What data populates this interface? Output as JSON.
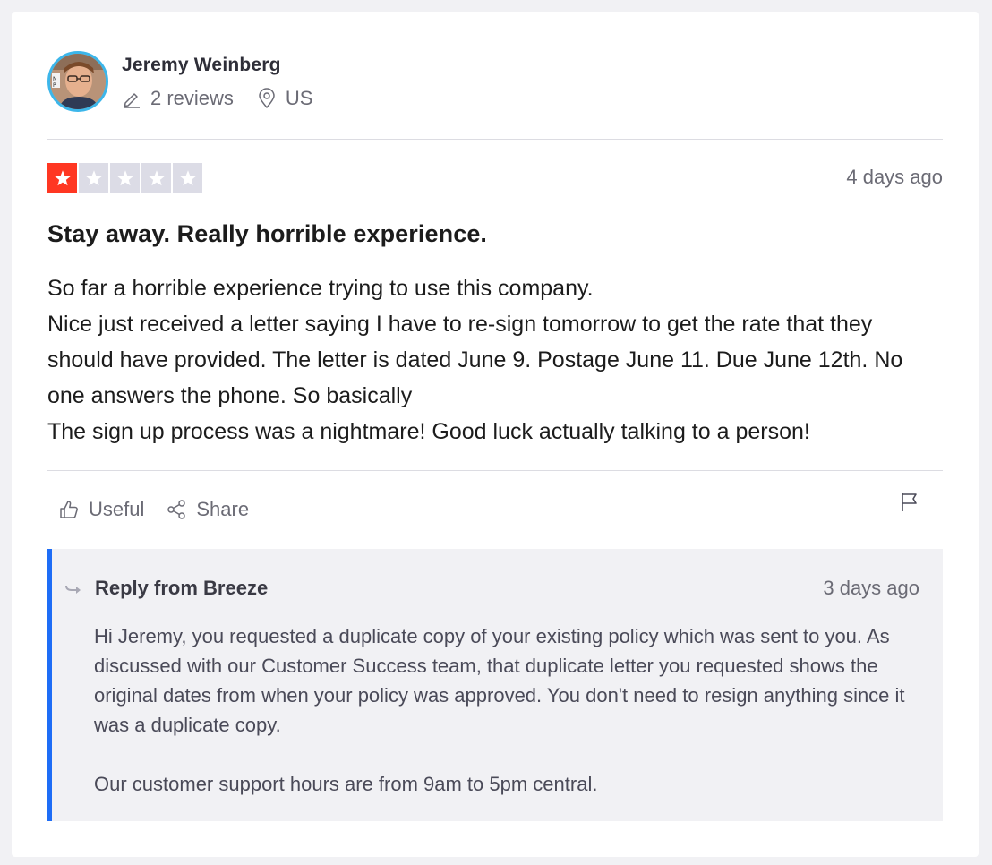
{
  "consumer": {
    "name": "Jeremy Weinberg",
    "reviews_count": "2 reviews",
    "location": "US"
  },
  "review": {
    "rating": 1,
    "rating_max": 5,
    "date": "4 days ago",
    "title": "Stay away. Really horrible experience.",
    "body_lines": [
      "So far a horrible experience trying to use this company.",
      "Nice just received a letter saying I have to re-sign tomorrow to get the rate that they should have provided. The letter is dated June 9. Postage June 11. Due June 12th. No one answers the phone. So basically",
      "The sign up process was a nightmare! Good luck actually talking to a person!"
    ]
  },
  "actions": {
    "useful_label": "Useful",
    "share_label": "Share"
  },
  "reply": {
    "title": "Reply from Breeze",
    "date": "3 days ago",
    "paragraphs": [
      "Hi Jeremy, you requested a duplicate copy of your existing policy which was sent to you. As discussed with our Customer Success team, that duplicate letter you requested shows the original dates from when your policy was approved. You don't need to resign anything since it was a duplicate copy.",
      "Our customer support hours are from 9am to 5pm central."
    ]
  },
  "colors": {
    "star_filled": "#ff3722",
    "star_empty": "#dcdce6",
    "reply_accent": "#1e6df6",
    "avatar_ring": "#3cb6ea"
  },
  "icons": {
    "star": "star-icon",
    "reviews": "pencil-icon",
    "location": "location-pin-icon",
    "useful": "thumbs-up-icon",
    "share": "share-icon",
    "flag": "flag-icon",
    "reply": "reply-arrow-icon"
  }
}
